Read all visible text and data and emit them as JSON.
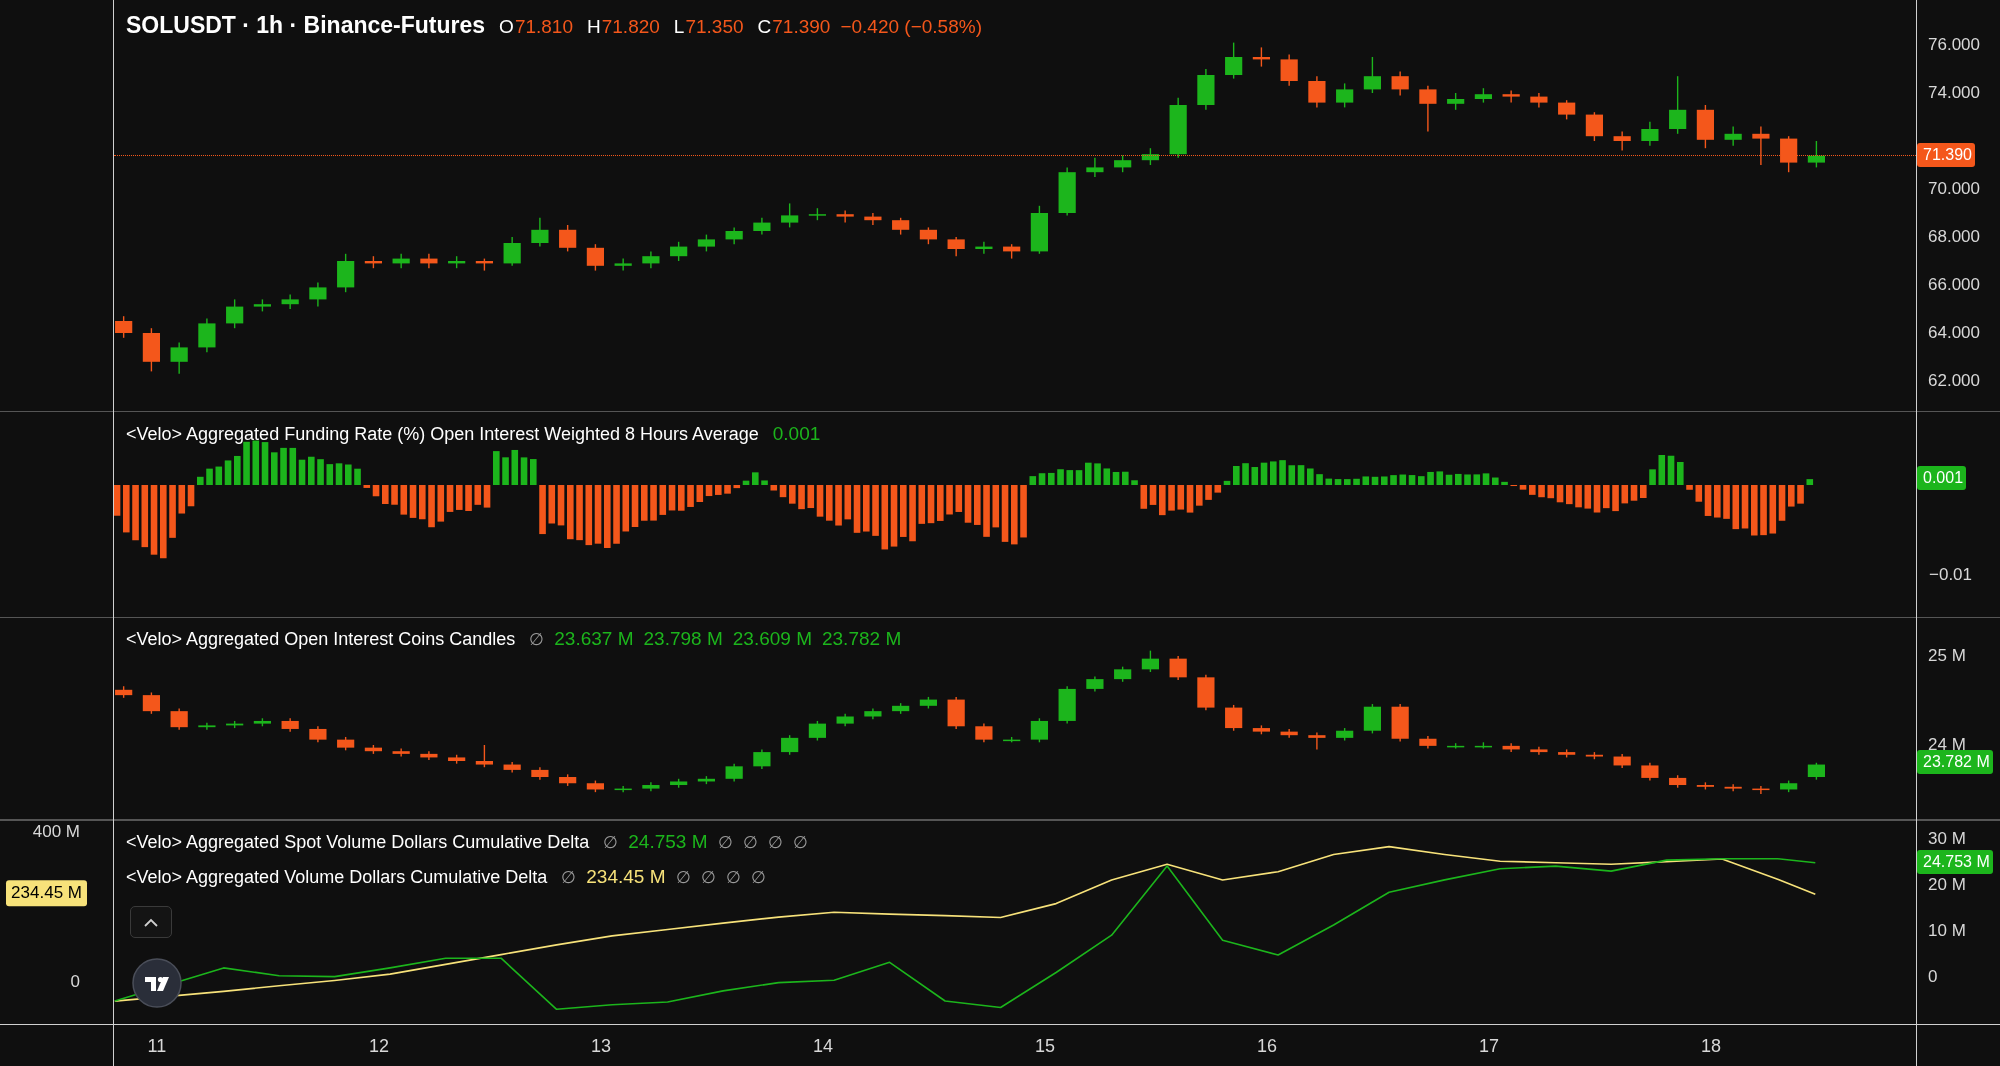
{
  "panes": [
    {
      "kind": "price",
      "legend": [
        {
          "segments": [
            {
              "text": "SOLUSDT · 1h · Binance-Futures",
              "kind": "title"
            },
            {
              "text": "O",
              "kind": "label"
            },
            {
              "text": "71.810",
              "kind": "down"
            },
            {
              "text": "H",
              "kind": "label"
            },
            {
              "text": "71.820",
              "kind": "down"
            },
            {
              "text": "L",
              "kind": "label"
            },
            {
              "text": "71.350",
              "kind": "down"
            },
            {
              "text": "C",
              "kind": "label"
            },
            {
              "text": "71.390",
              "kind": "down"
            },
            {
              "text": "−0.420 (−0.58%)",
              "kind": "down"
            }
          ]
        }
      ],
      "badges": [
        {
          "text": "71.390",
          "color": "#f4571b"
        }
      ],
      "charts": [
        {
          "chart_data": {
            "type": "candlestick",
            "xlim": [
              10.293,
              19.302
            ],
            "ylim": [
              60.708,
              77.875
            ],
            "yticks": [
              {
                "value": 76,
                "label": "76.000"
              },
              {
                "value": 74,
                "label": "74.000"
              },
              {
                "value": 70,
                "label": "70.000"
              },
              {
                "value": 68,
                "label": "68.000"
              },
              {
                "value": 66,
                "label": "66.000"
              },
              {
                "value": 64,
                "label": "64.000"
              },
              {
                "value": 62,
                "label": "62.000"
              }
            ],
            "x": [
              10.85,
              10.975,
              11.1,
              11.225,
              11.35,
              11.475,
              11.6,
              11.725,
              11.85,
              11.975,
              12.1,
              12.225,
              12.35,
              12.475,
              12.6,
              12.725,
              12.85,
              12.975,
              13.1,
              13.225,
              13.35,
              13.475,
              13.6,
              13.725,
              13.85,
              13.975,
              14.1,
              14.225,
              14.35,
              14.475,
              14.6,
              14.725,
              14.85,
              14.975,
              15.1,
              15.225,
              15.35,
              15.475,
              15.6,
              15.725,
              15.85,
              15.975,
              16.1,
              16.225,
              16.35,
              16.475,
              16.6,
              16.725,
              16.85,
              16.975,
              17.1,
              17.225,
              17.35,
              17.475,
              17.6,
              17.725,
              17.85,
              17.975,
              18.1,
              18.225,
              18.35,
              18.475
            ],
            "ohlc": [
              [
                64.5,
                64.7,
                63.8,
                64.0
              ],
              [
                64.0,
                64.2,
                62.4,
                62.8
              ],
              [
                62.8,
                63.6,
                62.3,
                63.4
              ],
              [
                63.4,
                64.6,
                63.2,
                64.4
              ],
              [
                64.4,
                65.4,
                64.2,
                65.1
              ],
              [
                65.1,
                65.4,
                64.9,
                65.2
              ],
              [
                65.2,
                65.6,
                65.0,
                65.4
              ],
              [
                65.4,
                66.1,
                65.1,
                65.9
              ],
              [
                65.9,
                67.3,
                65.7,
                67.0
              ],
              [
                67.0,
                67.2,
                66.7,
                66.9
              ],
              [
                66.9,
                67.3,
                66.7,
                67.1
              ],
              [
                67.1,
                67.3,
                66.7,
                66.9
              ],
              [
                66.9,
                67.2,
                66.7,
                67.0
              ],
              [
                67.0,
                67.1,
                66.6,
                66.9
              ],
              [
                66.9,
                68.0,
                66.8,
                67.75
              ],
              [
                67.75,
                68.8,
                67.6,
                68.3
              ],
              [
                68.3,
                68.5,
                67.4,
                67.55
              ],
              [
                67.55,
                67.7,
                66.6,
                66.8
              ],
              [
                66.8,
                67.1,
                66.6,
                66.9
              ],
              [
                66.9,
                67.4,
                66.7,
                67.2
              ],
              [
                67.2,
                67.8,
                67.0,
                67.6
              ],
              [
                67.6,
                68.1,
                67.4,
                67.9
              ],
              [
                67.9,
                68.4,
                67.7,
                68.25
              ],
              [
                68.25,
                68.8,
                68.1,
                68.6
              ],
              [
                68.6,
                69.4,
                68.4,
                68.9
              ],
              [
                68.9,
                69.2,
                68.7,
                68.95
              ],
              [
                68.95,
                69.1,
                68.6,
                68.85
              ],
              [
                68.85,
                69.0,
                68.5,
                68.7
              ],
              [
                68.7,
                68.8,
                68.1,
                68.3
              ],
              [
                68.3,
                68.4,
                67.7,
                67.9
              ],
              [
                67.9,
                68.0,
                67.2,
                67.5
              ],
              [
                67.5,
                67.8,
                67.3,
                67.6
              ],
              [
                67.6,
                67.7,
                67.1,
                67.4
              ],
              [
                67.4,
                69.3,
                67.3,
                69.0
              ],
              [
                69.0,
                70.9,
                68.9,
                70.7
              ],
              [
                70.7,
                71.3,
                70.5,
                70.9
              ],
              [
                70.9,
                71.4,
                70.7,
                71.2
              ],
              [
                71.2,
                71.7,
                71.0,
                71.45
              ],
              [
                71.45,
                73.8,
                71.3,
                73.5
              ],
              [
                73.5,
                75.0,
                73.3,
                74.75
              ],
              [
                74.75,
                76.1,
                74.6,
                75.5
              ],
              [
                75.5,
                75.9,
                75.1,
                75.4
              ],
              [
                75.4,
                75.6,
                74.3,
                74.5
              ],
              [
                74.5,
                74.7,
                73.4,
                73.6
              ],
              [
                73.6,
                74.4,
                73.4,
                74.15
              ],
              [
                74.15,
                75.5,
                74.0,
                74.7
              ],
              [
                74.7,
                74.9,
                73.9,
                74.15
              ],
              [
                74.15,
                74.3,
                72.4,
                73.55
              ],
              [
                73.55,
                74.0,
                73.3,
                73.75
              ],
              [
                73.75,
                74.2,
                73.6,
                73.95
              ],
              [
                73.95,
                74.1,
                73.6,
                73.85
              ],
              [
                73.85,
                74.0,
                73.4,
                73.6
              ],
              [
                73.6,
                73.7,
                72.9,
                73.1
              ],
              [
                73.1,
                73.2,
                72.0,
                72.2
              ],
              [
                72.2,
                72.4,
                71.6,
                72.0
              ],
              [
                72.0,
                72.8,
                71.8,
                72.5
              ],
              [
                72.5,
                74.7,
                72.3,
                73.3
              ],
              [
                73.3,
                73.5,
                71.7,
                72.05
              ],
              [
                72.05,
                72.6,
                71.8,
                72.3
              ],
              [
                72.3,
                72.6,
                71.0,
                72.1
              ],
              [
                72.1,
                72.2,
                70.7,
                71.1
              ],
              [
                71.1,
                72.0,
                70.9,
                71.39
              ]
            ]
          }
        }
      ]
    },
    {
      "kind": "funding",
      "legend": [
        {
          "segments": [
            {
              "text": "<Velo> Aggregated Funding Rate (%) Open Interest Weighted 8 Hours Average",
              "kind": "name"
            },
            {
              "text": "0.001",
              "kind": "up"
            }
          ]
        }
      ],
      "right_ticks": [
        "−0.01"
      ],
      "badges": [
        {
          "text": "0.001",
          "color": "#1cb51c"
        }
      ]
    },
    {
      "kind": "open_interest",
      "legend": [
        {
          "segments": [
            {
              "text": "<Velo> Aggregated Open Interest Coins Candles",
              "kind": "name"
            },
            {
              "text": "∅",
              "kind": "na"
            },
            {
              "text": "23.637 M",
              "kind": "up"
            },
            {
              "text": "23.798 M",
              "kind": "up"
            },
            {
              "text": "23.609 M",
              "kind": "up"
            },
            {
              "text": "23.782 M",
              "kind": "up"
            }
          ]
        }
      ],
      "badges": [
        {
          "text": "23.782 M",
          "color": "#1cb51c"
        }
      ],
      "charts": [
        {
          "chart_data": {
            "type": "candlestick",
            "xlim": [
              10.293,
              19.302
            ],
            "ylim": [
              23.157,
              25.438
            ],
            "yticks": [
              {
                "value": 25,
                "label": "25 M"
              },
              {
                "value": 24,
                "label": "24 M"
              }
            ],
            "x": [
              10.85,
              10.975,
              11.1,
              11.225,
              11.35,
              11.475,
              11.6,
              11.725,
              11.85,
              11.975,
              12.1,
              12.225,
              12.35,
              12.475,
              12.6,
              12.725,
              12.85,
              12.975,
              13.1,
              13.225,
              13.35,
              13.475,
              13.6,
              13.725,
              13.85,
              13.975,
              14.1,
              14.225,
              14.35,
              14.475,
              14.6,
              14.725,
              14.85,
              14.975,
              15.1,
              15.225,
              15.35,
              15.475,
              15.6,
              15.725,
              15.85,
              15.975,
              16.1,
              16.225,
              16.35,
              16.475,
              16.6,
              16.725,
              16.85,
              16.975,
              17.1,
              17.225,
              17.35,
              17.475,
              17.6,
              17.725,
              17.85,
              17.975,
              18.1,
              18.225,
              18.35,
              18.475
            ],
            "ohlc": [
              [
                24.62,
                24.66,
                24.53,
                24.56
              ],
              [
                24.56,
                24.59,
                24.35,
                24.38
              ],
              [
                24.38,
                24.41,
                24.17,
                24.2
              ],
              [
                24.2,
                24.25,
                24.17,
                24.22
              ],
              [
                24.22,
                24.27,
                24.19,
                24.24
              ],
              [
                24.24,
                24.3,
                24.21,
                24.27
              ],
              [
                24.27,
                24.3,
                24.15,
                24.18
              ],
              [
                24.18,
                24.21,
                24.03,
                24.06
              ],
              [
                24.06,
                24.09,
                23.94,
                23.97
              ],
              [
                23.97,
                24.0,
                23.9,
                23.93
              ],
              [
                23.93,
                23.96,
                23.87,
                23.9
              ],
              [
                23.9,
                23.93,
                23.83,
                23.86
              ],
              [
                23.86,
                23.89,
                23.79,
                23.82
              ],
              [
                23.82,
                24.0,
                23.75,
                23.78
              ],
              [
                23.78,
                23.81,
                23.69,
                23.72
              ],
              [
                23.72,
                23.75,
                23.61,
                23.64
              ],
              [
                23.64,
                23.67,
                23.54,
                23.57
              ],
              [
                23.57,
                23.6,
                23.47,
                23.5
              ],
              [
                23.5,
                23.54,
                23.47,
                23.51
              ],
              [
                23.51,
                23.58,
                23.48,
                23.55
              ],
              [
                23.55,
                23.62,
                23.52,
                23.59
              ],
              [
                23.59,
                23.65,
                23.56,
                23.62
              ],
              [
                23.62,
                23.79,
                23.59,
                23.76
              ],
              [
                23.76,
                23.95,
                23.73,
                23.92
              ],
              [
                23.92,
                24.11,
                23.89,
                24.08
              ],
              [
                24.08,
                24.27,
                24.05,
                24.24
              ],
              [
                24.24,
                24.35,
                24.21,
                24.32
              ],
              [
                24.32,
                24.41,
                24.29,
                24.38
              ],
              [
                24.38,
                24.47,
                24.35,
                24.44
              ],
              [
                24.44,
                24.54,
                24.41,
                24.51
              ],
              [
                24.51,
                24.54,
                24.18,
                24.21
              ],
              [
                24.21,
                24.24,
                24.03,
                24.06
              ],
              [
                24.06,
                24.09,
                24.03,
                24.06
              ],
              [
                24.06,
                24.3,
                24.03,
                24.27
              ],
              [
                24.27,
                24.66,
                24.24,
                24.63
              ],
              [
                24.63,
                24.77,
                24.6,
                24.74
              ],
              [
                24.74,
                24.88,
                24.71,
                24.85
              ],
              [
                24.85,
                25.06,
                24.82,
                24.97
              ],
              [
                24.97,
                25.0,
                24.73,
                24.76
              ],
              [
                24.76,
                24.79,
                24.39,
                24.42
              ],
              [
                24.42,
                24.45,
                24.16,
                24.19
              ],
              [
                24.19,
                24.22,
                24.12,
                24.15
              ],
              [
                24.15,
                24.18,
                24.08,
                24.11
              ],
              [
                24.11,
                24.14,
                23.95,
                24.08
              ],
              [
                24.08,
                24.19,
                24.05,
                24.16
              ],
              [
                24.16,
                24.46,
                24.13,
                24.43
              ],
              [
                24.43,
                24.46,
                24.04,
                24.07
              ],
              [
                24.07,
                24.1,
                23.96,
                23.99
              ],
              [
                23.99,
                24.02,
                23.96,
                23.99
              ],
              [
                23.99,
                24.03,
                23.96,
                23.99
              ],
              [
                23.99,
                24.02,
                23.92,
                23.95
              ],
              [
                23.95,
                23.98,
                23.89,
                23.92
              ],
              [
                23.92,
                23.95,
                23.86,
                23.89
              ],
              [
                23.89,
                23.92,
                23.84,
                23.87
              ],
              [
                23.87,
                23.9,
                23.74,
                23.77
              ],
              [
                23.77,
                23.8,
                23.6,
                23.63
              ],
              [
                23.63,
                23.66,
                23.52,
                23.55
              ],
              [
                23.55,
                23.58,
                23.5,
                23.53
              ],
              [
                23.53,
                23.56,
                23.48,
                23.51
              ],
              [
                23.51,
                23.54,
                23.45,
                23.5
              ],
              [
                23.5,
                23.6,
                23.47,
                23.57
              ],
              [
                23.64,
                23.8,
                23.61,
                23.78
              ]
            ]
          }
        }
      ]
    },
    {
      "kind": "delta",
      "legend": [
        {
          "segments": [
            {
              "text": "∅",
              "kind": "na"
            },
            {
              "text": "24.753 M",
              "kind": "up"
            },
            {
              "text": "∅",
              "kind": "na"
            },
            {
              "text": "∅",
              "kind": "na"
            },
            {
              "text": "∅",
              "kind": "na"
            },
            {
              "text": "∅",
              "kind": "na"
            }
          ]
        },
        {
          "segments": [
            {
              "text": "∅",
              "kind": "na"
            },
            {
              "text": "234.45 M",
              "kind": "yellow"
            },
            {
              "text": "∅",
              "kind": "na"
            },
            {
              "text": "∅",
              "kind": "na"
            },
            {
              "text": "∅",
              "kind": "na"
            },
            {
              "text": "∅",
              "kind": "na"
            }
          ]
        }
      ],
      "badges": [
        {
          "text": "24.753 M",
          "color": "#1cb51c"
        },
        {
          "text": "234.45 M",
          "color": "#f7e27a"
        }
      ],
      "charts": [
        {
          "chart_data": {
            "type": "line",
            "xlim": [
              10.293,
              19.302
            ],
            "ylim": [
              -114.7,
              432
            ],
            "yticks": [
              {
                "value": 400,
                "label": "400 M"
              },
              {
                "value": 0,
                "label": "0"
              }
            ],
            "xticks": [
              11,
              12,
              13,
              14,
              15,
              16,
              17,
              18
            ],
            "x": [
              10.81,
              11.3,
              11.55,
              11.8,
              12.05,
              12.3,
              12.55,
              12.8,
              13.05,
              13.3,
              13.55,
              13.8,
              14.05,
              14.3,
              14.55,
              14.8,
              15.05,
              15.3,
              15.55,
              15.8,
              16.05,
              16.3,
              16.55,
              16.8,
              17.05,
              17.3,
              17.55,
              17.8,
              18.05,
              18.3,
              18.47
            ],
            "series": [
              {
                "name": "<Velo> Aggregated Volume Dollars Cumulative Delta",
                "color": "#f7e27a",
                "values": [
                  -51,
                  -25,
                  -10,
                  4,
                  21,
                  47,
                  73,
                  99,
                  123,
                  140,
                  157,
                  173,
                  186,
                  181,
                  177,
                  172,
                  209,
                  272,
                  314,
                  272,
                  294,
                  340,
                  361,
                  340,
                  322,
                  318,
                  314,
                  321,
                  328,
                  274,
                  234
                ]
              }
            ]
          }
        },
        {
          "chart_data": {
            "type": "line",
            "xlim": [
              10.293,
              19.302
            ],
            "ylim": [
              -10.4,
              34.1
            ],
            "yticks": [
              {
                "value": 30,
                "label": "30 M"
              },
              {
                "value": 20,
                "label": "20 M"
              },
              {
                "value": 10,
                "label": "10 M"
              },
              {
                "value": 0,
                "label": "0"
              }
            ],
            "x": [
              10.81,
              11.3,
              11.55,
              11.8,
              12.05,
              12.3,
              12.55,
              12.8,
              13.05,
              13.3,
              13.55,
              13.8,
              14.05,
              14.3,
              14.55,
              14.8,
              15.05,
              15.3,
              15.55,
              15.8,
              16.05,
              16.3,
              16.55,
              16.8,
              17.05,
              17.3,
              17.55,
              17.8,
              18.05,
              18.3,
              18.47
            ],
            "series": [
              {
                "name": "<Velo> Aggregated Spot Volume Dollars Cumulative Delta",
                "color": "#1cb51c",
                "values": [
                  -5.2,
                  2.0,
                  0.3,
                  0.1,
                  2.0,
                  4.1,
                  4.1,
                  -7.0,
                  -6.0,
                  -5.4,
                  -3.0,
                  -1.2,
                  -0.7,
                  3.2,
                  -5.2,
                  -6.6,
                  1.0,
                  9.1,
                  24.1,
                  8.0,
                  4.8,
                  11.3,
                  18.4,
                  21.1,
                  23.5,
                  24.1,
                  23.0,
                  25.4,
                  25.7,
                  25.7,
                  24.8
                ]
              }
            ]
          }
        }
      ]
    }
  ]
}
